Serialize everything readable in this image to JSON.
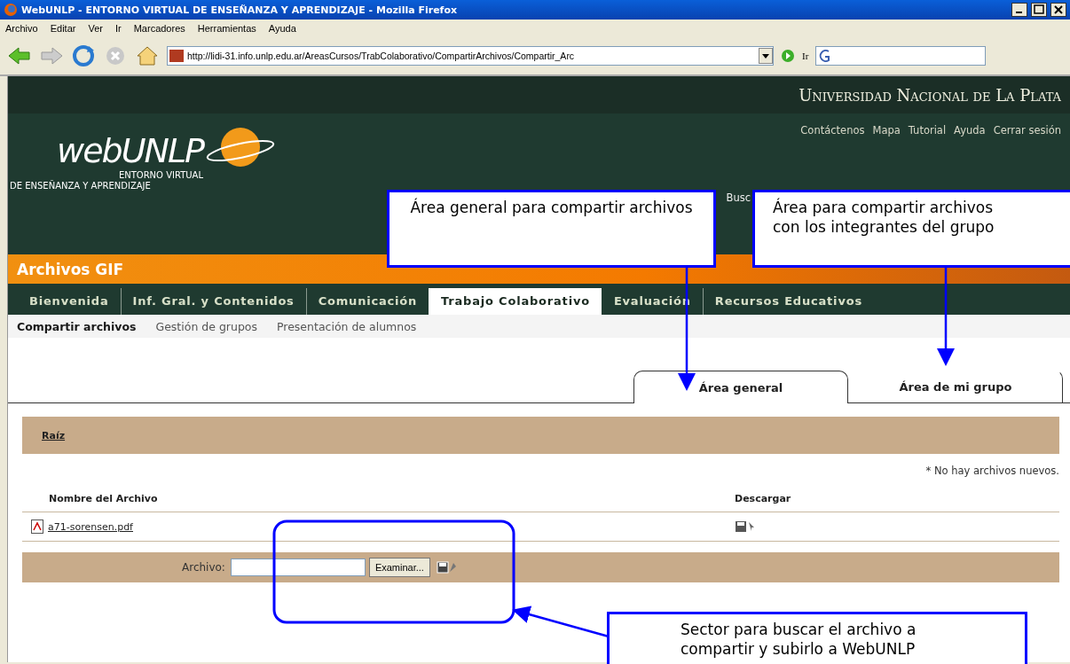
{
  "window": {
    "title": "WebUNLP - ENTORNO VIRTUAL DE ENSEÑANZA Y APRENDIZAJE - Mozilla Firefox"
  },
  "menu": [
    "Archivo",
    "Editar",
    "Ver",
    "Ir",
    "Marcadores",
    "Herramientas",
    "Ayuda"
  ],
  "address_bar": {
    "url": "http://lidi-31.info.unlp.edu.ar/AreasCursos/TrabColaborativo/CompartirArchivos/Compartir_Arc",
    "go_label": "Ir"
  },
  "header": {
    "university": "Universidad Nacional de La Plata",
    "logo_text": "webUNLP",
    "logo_line_1": "ENTORNO VIRTUAL",
    "logo_line_2": "DE ENSEÑANZA Y APRENDIZAJE",
    "links": [
      "Contáctenos",
      "Mapa",
      "Tutorial",
      "Ayuda",
      "Cerrar sesión"
    ],
    "search_label": "Busc"
  },
  "course_title": "Archivos GIF",
  "nav": [
    {
      "label": "Bienvenida",
      "selected": false
    },
    {
      "label": "Inf. Gral. y Contenidos",
      "selected": false
    },
    {
      "label": "Comunicación",
      "selected": false
    },
    {
      "label": "Trabajo Colaborativo",
      "selected": true
    },
    {
      "label": "Evaluación",
      "selected": false
    },
    {
      "label": "Recursos Educativos",
      "selected": false
    }
  ],
  "subnav": [
    {
      "label": "Compartir archivos",
      "selected": true
    },
    {
      "label": "Gestión de grupos",
      "selected": false
    },
    {
      "label": "Presentación de alumnos",
      "selected": false
    }
  ],
  "tabs": [
    {
      "label": "Área general",
      "selected": true
    },
    {
      "label": "Área de mi grupo",
      "selected": false
    }
  ],
  "breadcrumb": "Raíz",
  "notice": "* No hay archivos nuevos.",
  "table": {
    "columns": [
      "Nombre del Archivo",
      "Descargar"
    ],
    "rows": [
      {
        "name": "a71-sorensen.pdf"
      }
    ]
  },
  "upload": {
    "label": "Archivo:",
    "button": "Examinar..."
  },
  "annotations": [
    {
      "text": "Área general para compartir archivos"
    },
    {
      "text": "Área para compartir archivos con los integrantes del grupo"
    },
    {
      "text": "Sector para buscar el archivo a compartir y subirlo a WebUNLP"
    }
  ]
}
